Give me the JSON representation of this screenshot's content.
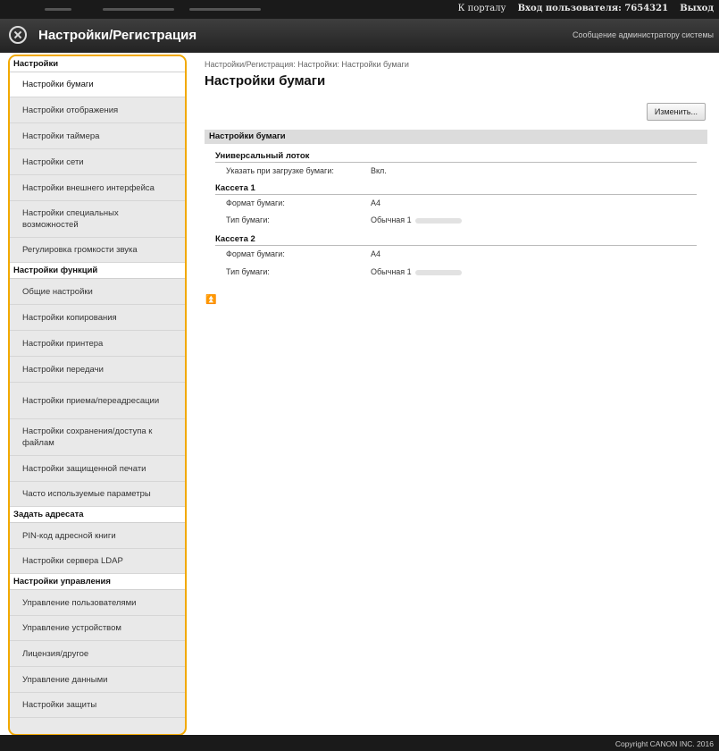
{
  "topbar": {
    "portal_link": "К порталу",
    "login_label": "Вход пользователя: 7654321",
    "logout_link": "Выход"
  },
  "header": {
    "title": "Настройки/Регистрация",
    "admin_message": "Сообщение администратору системы"
  },
  "sidebar": {
    "sections": [
      {
        "heading": "Настройки",
        "items": [
          {
            "label": "Настройки бумаги",
            "active": true
          },
          {
            "label": "Настройки отображения"
          },
          {
            "label": "Настройки таймера"
          },
          {
            "label": "Настройки сети"
          },
          {
            "label": "Настройки внешнего интерфейса"
          },
          {
            "label": "Настройки специальных возможностей"
          },
          {
            "label": "Регулировка громкости звука"
          }
        ]
      },
      {
        "heading": "Настройки функций",
        "items": [
          {
            "label": "Общие настройки"
          },
          {
            "label": "Настройки копирования"
          },
          {
            "label": "Настройки принтера"
          },
          {
            "label": "Настройки передачи"
          },
          {
            "label": "Настройки приема/переадресации"
          },
          {
            "label": "Настройки сохранения/доступа к файлам"
          },
          {
            "label": "Настройки защищенной печати"
          },
          {
            "label": "Часто используемые параметры"
          }
        ]
      },
      {
        "heading": "Задать адресата",
        "items": [
          {
            "label": "PIN-код адресной книги"
          },
          {
            "label": "Настройки сервера LDAP"
          }
        ]
      },
      {
        "heading": "Настройки управления",
        "items": [
          {
            "label": "Управление пользователями"
          },
          {
            "label": "Управление устройством"
          },
          {
            "label": "Лицензия/другое"
          },
          {
            "label": "Управление данными"
          },
          {
            "label": "Настройки защиты"
          }
        ]
      }
    ]
  },
  "main": {
    "breadcrumb": "Настройки/Регистрация: Настройки: Настройки бумаги",
    "title": "Настройки бумаги",
    "edit_button": "Изменить...",
    "section_title": "Настройки бумаги",
    "groups": [
      {
        "name": "Универсальный лоток",
        "rows": [
          {
            "label": "Указать при загрузке бумаги:",
            "value": "Вкл."
          }
        ]
      },
      {
        "name": "Кассета 1",
        "rows": [
          {
            "label": "Формат бумаги:",
            "value": "A4"
          },
          {
            "label": "Тип бумаги:",
            "value": "Обычная 1"
          }
        ]
      },
      {
        "name": "Кассета 2",
        "rows": [
          {
            "label": "Формат бумаги:",
            "value": "A4"
          },
          {
            "label": "Тип бумаги:",
            "value": "Обычная 1"
          }
        ]
      }
    ],
    "to_top_glyph": "⏫"
  },
  "footer": {
    "copyright": "Copyright CANON INC. 2016"
  }
}
